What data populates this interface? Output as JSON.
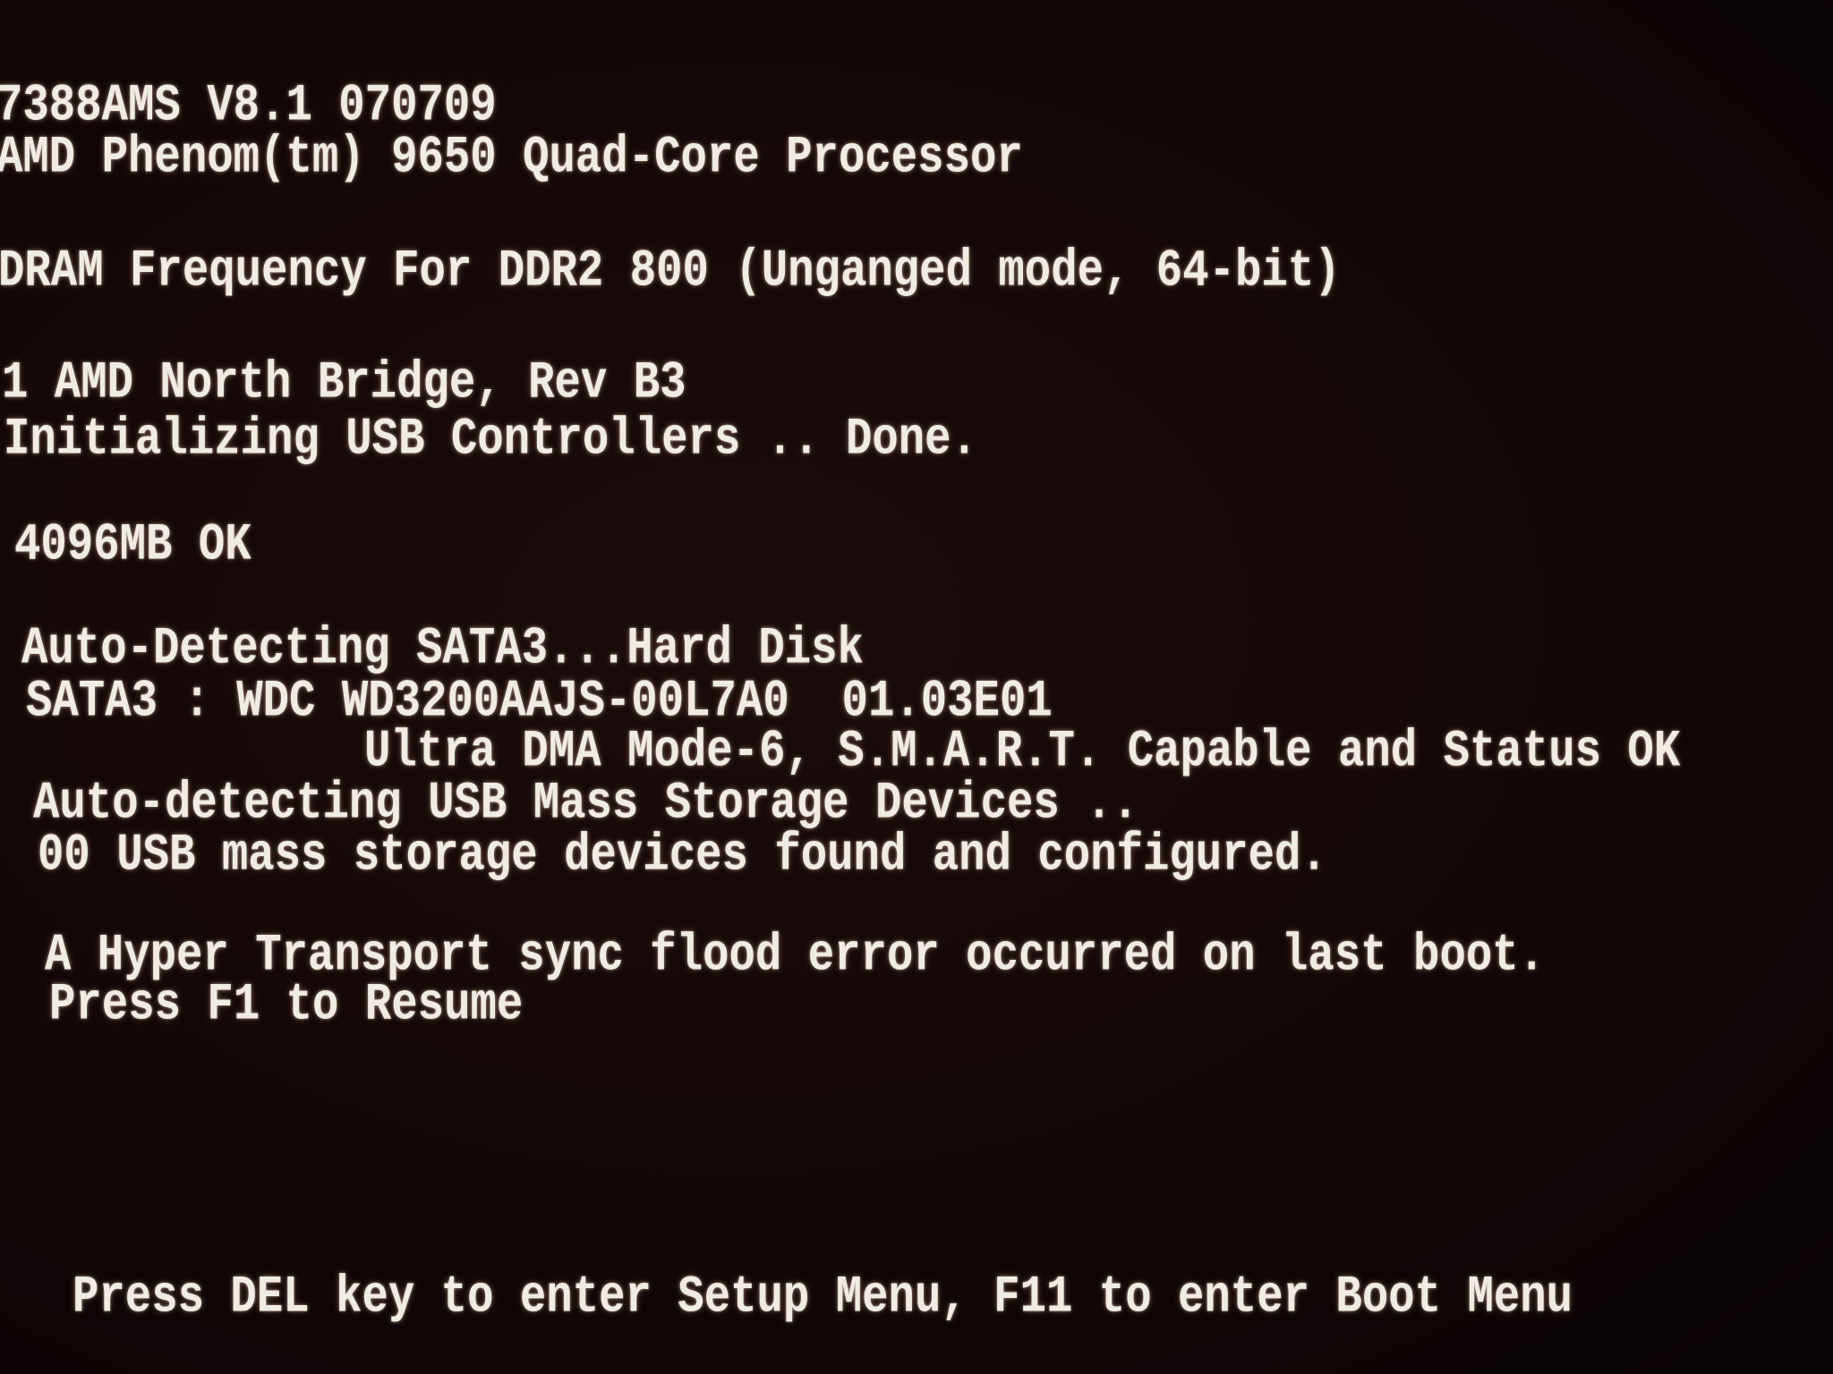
{
  "bios_screen": {
    "bios_version": "7388AMS V8.1 070709",
    "cpu": "AMD Phenom(tm) 9650 Quad-Core Processor",
    "dram": "DRAM Frequency For DDR2 800 (Unganged mode, 64-bit)",
    "north_bridge": "1 AMD North Bridge, Rev B3",
    "usb_init": "Initializing USB Controllers .. Done.",
    "memory": "4096MB OK",
    "sata_detect": "Auto-Detecting SATA3...Hard Disk",
    "sata_device": "SATA3 : WDC WD3200AAJS-00L7A0  01.03E01",
    "sata_status": "Ultra DMA Mode-6, S.M.A.R.T. Capable and Status OK",
    "usb_detect": "Auto-detecting USB Mass Storage Devices ..",
    "usb_found": "00 USB mass storage devices found and configured.",
    "error_message": "A Hyper Transport sync flood error occurred on last boot.",
    "resume_prompt": "Press F1 to Resume",
    "footer_prompt": "Press DEL key to enter Setup Menu, F11 to enter Boot Menu"
  }
}
